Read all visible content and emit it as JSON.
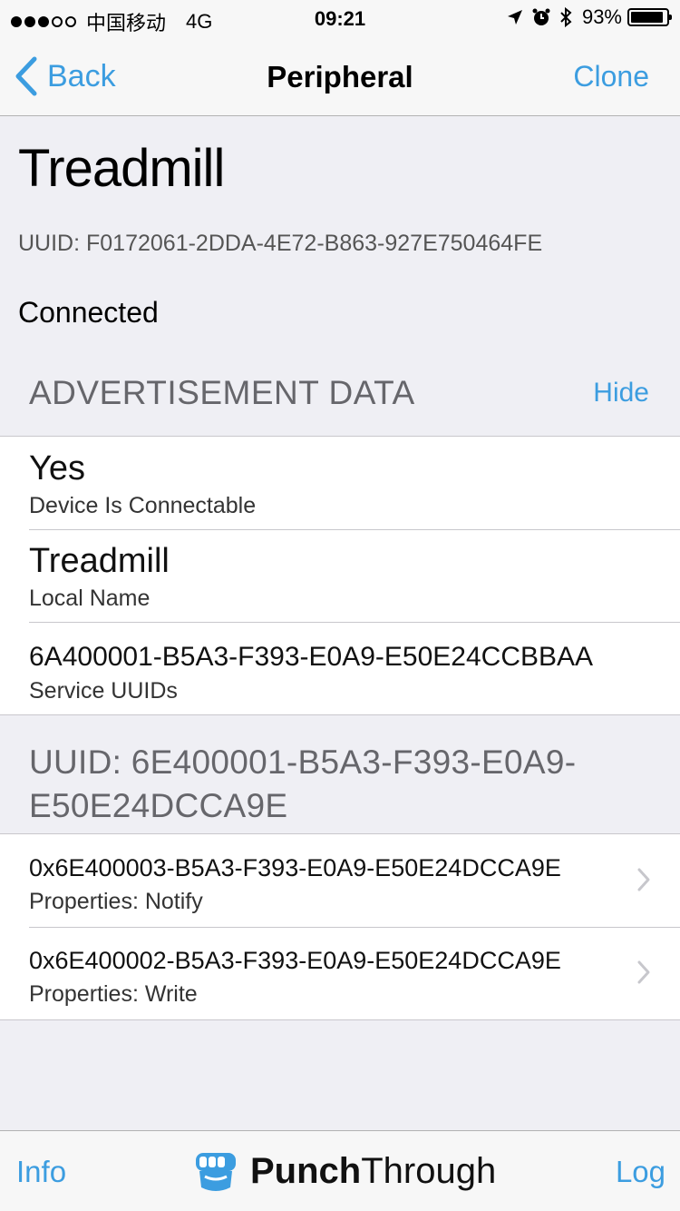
{
  "status_bar": {
    "carrier": "中国移动",
    "network": "4G",
    "time": "09:21",
    "battery": "93%",
    "battery_level": 0.93
  },
  "nav": {
    "back_label": "Back",
    "title": "Peripheral",
    "clone_label": "Clone"
  },
  "device": {
    "name": "Treadmill",
    "uuid": "UUID: F0172061-2DDA-4E72-B863-927E750464FE",
    "status": "Connected"
  },
  "advertisement": {
    "header": "ADVERTISEMENT DATA",
    "hide_label": "Hide",
    "rows": [
      {
        "value": "Yes",
        "label": "Device Is Connectable"
      },
      {
        "value": "Treadmill",
        "label": "Local Name"
      },
      {
        "value": "6A400001-B5A3-F393-E0A9-E50E24CCBBAA",
        "label": "Service UUIDs"
      }
    ]
  },
  "service": {
    "header": "UUID: 6E400001-B5A3-F393-E0A9-E50E24DCCA9E",
    "characteristics": [
      {
        "value": "0x6E400003-B5A3-F393-E0A9-E50E24DCCA9E",
        "label": "Properties: Notify"
      },
      {
        "value": "0x6E400002-B5A3-F393-E0A9-E50E24DCCA9E",
        "label": "Properties: Write"
      }
    ]
  },
  "tab_bar": {
    "info_label": "Info",
    "brand_bold": "Punch",
    "brand_thin": "Through",
    "log_label": "Log"
  },
  "colors": {
    "accent": "#3c9de0",
    "background": "#efeff4",
    "bar": "#f7f7f7"
  }
}
